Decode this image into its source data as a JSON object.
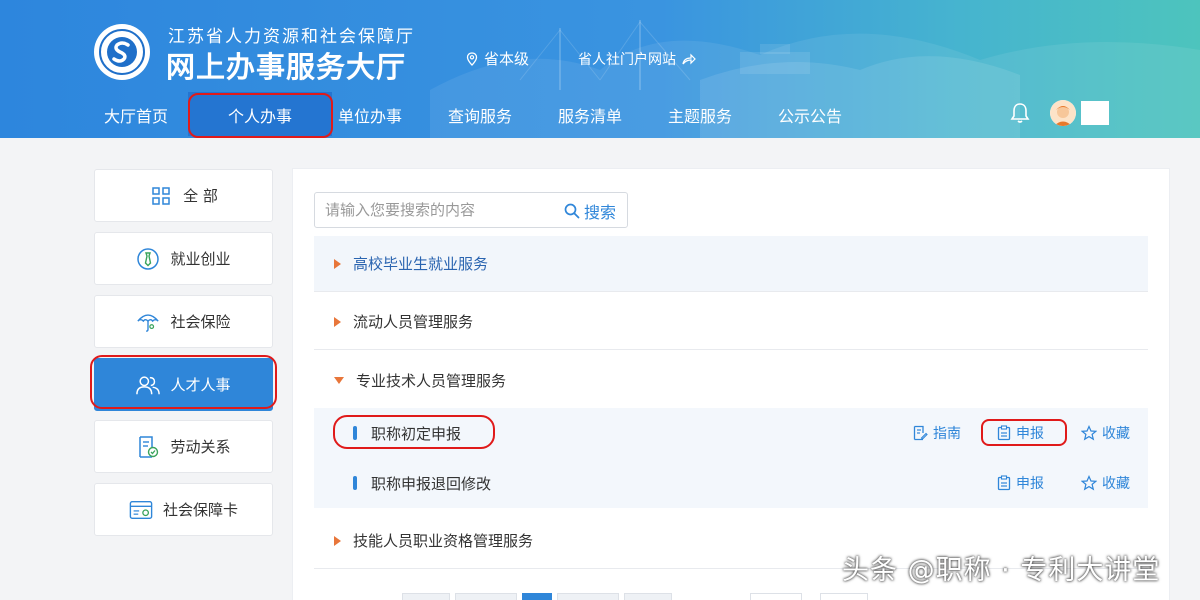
{
  "header": {
    "org_name": "江苏省人力资源和社会保障厅",
    "hall_name": "网上办事服务大厅",
    "region": "省本级",
    "portal_link": "省人社门户网站",
    "logo_icon": "social-security-logo-icon",
    "colors": {
      "primary": "#2d86dd",
      "accent": "#4dc4bd"
    }
  },
  "nav": {
    "items": [
      {
        "label": "大厅首页"
      },
      {
        "label": "个人办事",
        "active": true
      },
      {
        "label": "单位办事"
      },
      {
        "label": "查询服务"
      },
      {
        "label": "服务清单"
      },
      {
        "label": "主题服务"
      },
      {
        "label": "公示公告"
      }
    ],
    "bell_icon": "bell-icon",
    "avatar_icon": "user-avatar-icon"
  },
  "sidebar": {
    "items": [
      {
        "label": "全 部",
        "icon": "grid-icon"
      },
      {
        "label": "就业创业",
        "icon": "tie-icon"
      },
      {
        "label": "社会保险",
        "icon": "umbrella-icon"
      },
      {
        "label": "人才人事",
        "icon": "people-icon",
        "active": true
      },
      {
        "label": "劳动关系",
        "icon": "document-icon"
      },
      {
        "label": "社会保障卡",
        "icon": "card-icon"
      }
    ]
  },
  "search": {
    "placeholder": "请输入您要搜索的内容",
    "button_label": "搜索"
  },
  "categories": [
    {
      "label": "高校毕业生就业服务",
      "expanded": false
    },
    {
      "label": "流动人员管理服务",
      "expanded": false
    },
    {
      "label": "专业技术人员管理服务",
      "expanded": true
    },
    {
      "label": "技能人员职业资格管理服务",
      "expanded": false
    }
  ],
  "services": [
    {
      "label": "职称初定申报",
      "guide": "指南",
      "apply": "申报",
      "favorite": "收藏"
    },
    {
      "label": "职称申报退回修改",
      "apply": "申报",
      "favorite": "收藏"
    }
  ],
  "watermark": "头条 @职称 · 专利大讲堂"
}
